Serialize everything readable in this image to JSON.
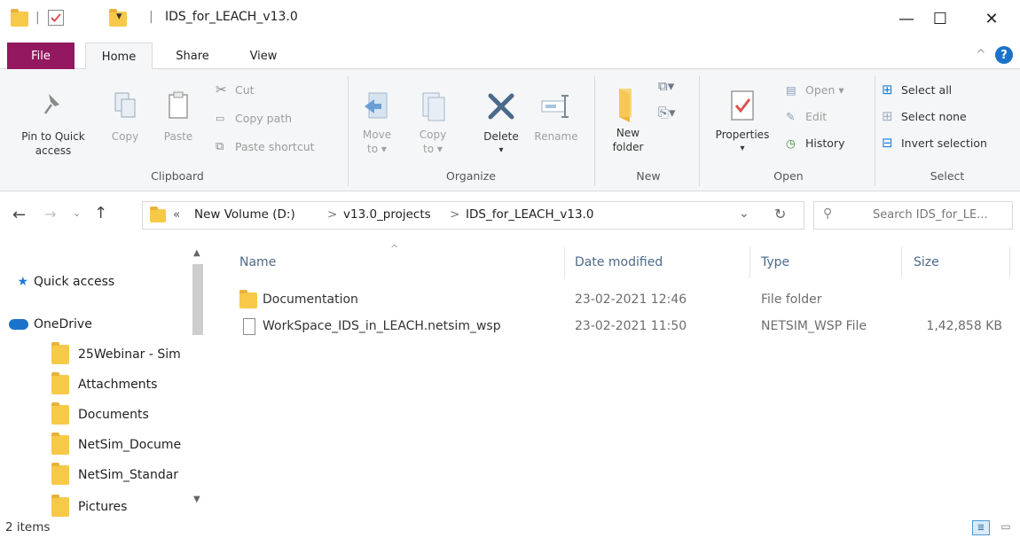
{
  "window": {
    "title": "IDS_for_LEACH_v13.0",
    "qat_dropdown_glyph": "▾",
    "controls": {
      "minimize": "—",
      "maximize": "☐",
      "close": "✕"
    }
  },
  "tabs": [
    {
      "label": "File"
    },
    {
      "label": "Home"
    },
    {
      "label": "Share"
    },
    {
      "label": "View"
    }
  ],
  "ribbon": {
    "collapse_glyph": "^",
    "help_glyph": "?",
    "clipboard": {
      "group_label": "Clipboard",
      "pin_line1": "Pin to Quick",
      "pin_line2": "access",
      "copy": "Copy",
      "paste": "Paste",
      "cut": "Cut",
      "copy_path": "Copy path",
      "paste_shortcut": "Paste shortcut"
    },
    "organize": {
      "group_label": "Organize",
      "move_line1": "Move",
      "move_line2": "to ▾",
      "copy_line1": "Copy",
      "copy_line2": "to ▾",
      "delete": "Delete",
      "delete_arrow": "▾",
      "rename": "Rename"
    },
    "new": {
      "group_label": "New",
      "folder_line1": "New",
      "folder_line2": "folder"
    },
    "open": {
      "group_label": "Open",
      "properties": "Properties",
      "properties_arrow": "▾",
      "open": "Open ▾",
      "edit": "Edit",
      "history": "History"
    },
    "select": {
      "group_label": "Select",
      "select_all": "Select all",
      "select_none": "Select none",
      "invert": "Invert selection"
    }
  },
  "address": {
    "chevrons": "«",
    "crumbs": [
      "New Volume (D:)",
      "v13.0_projects",
      "IDS_for_LEACH_v13.0"
    ],
    "separator": ">",
    "search_placeholder": "Search IDS_for_LE..."
  },
  "nav": {
    "items": [
      {
        "label": "Quick access",
        "icon": "star-icon"
      },
      {
        "label": "OneDrive",
        "icon": "cloud-icon"
      },
      {
        "label": "25Webinar - Sim",
        "icon": "folder-icon"
      },
      {
        "label": "Attachments",
        "icon": "folder-icon"
      },
      {
        "label": "Documents",
        "icon": "folder-icon"
      },
      {
        "label": "NetSim_Docume",
        "icon": "folder-icon"
      },
      {
        "label": "NetSim_Standar",
        "icon": "folder-icon"
      },
      {
        "label": "Pictures",
        "icon": "folder-icon"
      }
    ]
  },
  "filelist": {
    "columns": {
      "name": "Name",
      "date": "Date modified",
      "type": "Type",
      "size": "Size"
    },
    "sort_glyph": "^",
    "rows": [
      {
        "name": "Documentation",
        "date": "23-02-2021 12:46",
        "type": "File folder",
        "size": "",
        "icon": "folder-icon"
      },
      {
        "name": "WorkSpace_IDS_in_LEACH.netsim_wsp",
        "date": "23-02-2021 11:50",
        "type": "NETSIM_WSP File",
        "size": "1,42,858 KB",
        "icon": "file-icon"
      }
    ]
  },
  "status": {
    "item_count": "2 items"
  }
}
